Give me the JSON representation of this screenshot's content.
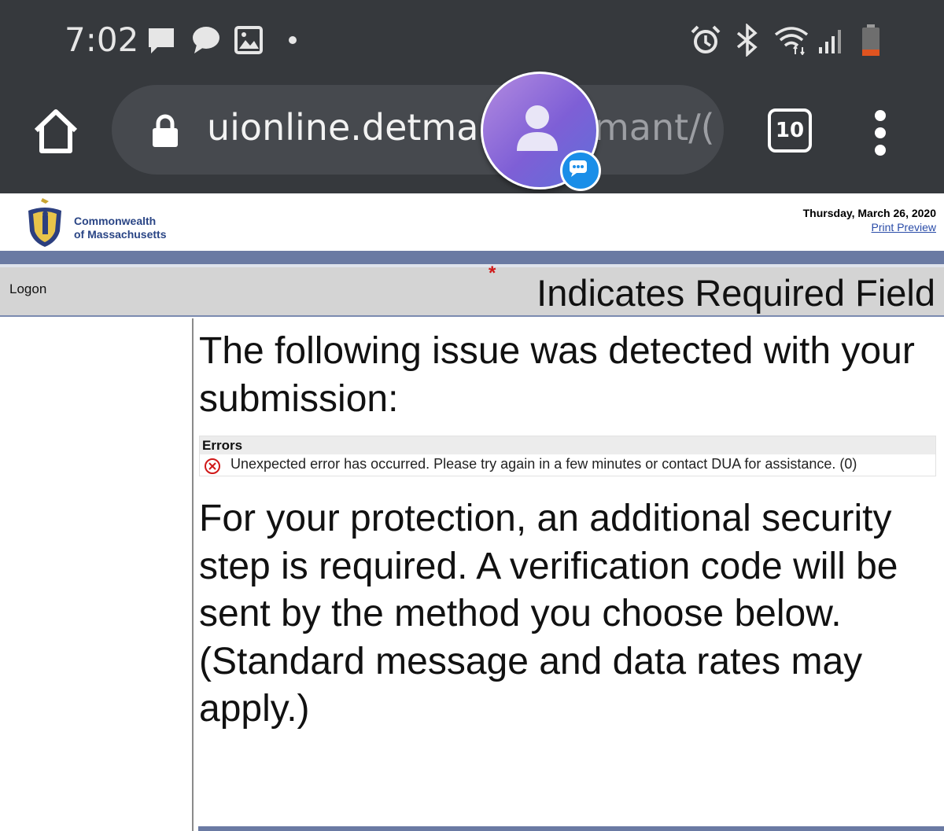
{
  "status_bar": {
    "time": "7:02",
    "icons": [
      "message-icon",
      "chat-icon",
      "image-icon",
      "dot-icon",
      "alarm-icon",
      "bluetooth-icon",
      "wifi-icon",
      "signal-icon",
      "battery-icon"
    ]
  },
  "browser": {
    "url_visible": "uionline.detma.o",
    "url_tail": "mant/(",
    "tab_count": "10"
  },
  "header": {
    "brand_line1": "Commonwealth",
    "brand_line2": "of Massachusetts",
    "date": "Thursday, March 26, 2020",
    "print_preview": "Print Preview"
  },
  "nav": {
    "logon": "Logon",
    "required_star": "*",
    "required_text": "Indicates Required Field"
  },
  "main": {
    "issue_heading": "The following issue was detected with your submission:",
    "errors_title": "Errors",
    "error_message": "Unexpected error has occurred. Please try again in a few minutes or contact DUA for assistance. (0)",
    "protection_text": "For your protection, an additional security step is required. A verification code will be sent by the method you choose below.",
    "rates_text": "(Standard message and data rates may apply.)"
  },
  "colors": {
    "chrome": "#36393d",
    "brand_blue": "#2a4585",
    "band": "#6a7aa3",
    "error_red": "#d01818"
  }
}
